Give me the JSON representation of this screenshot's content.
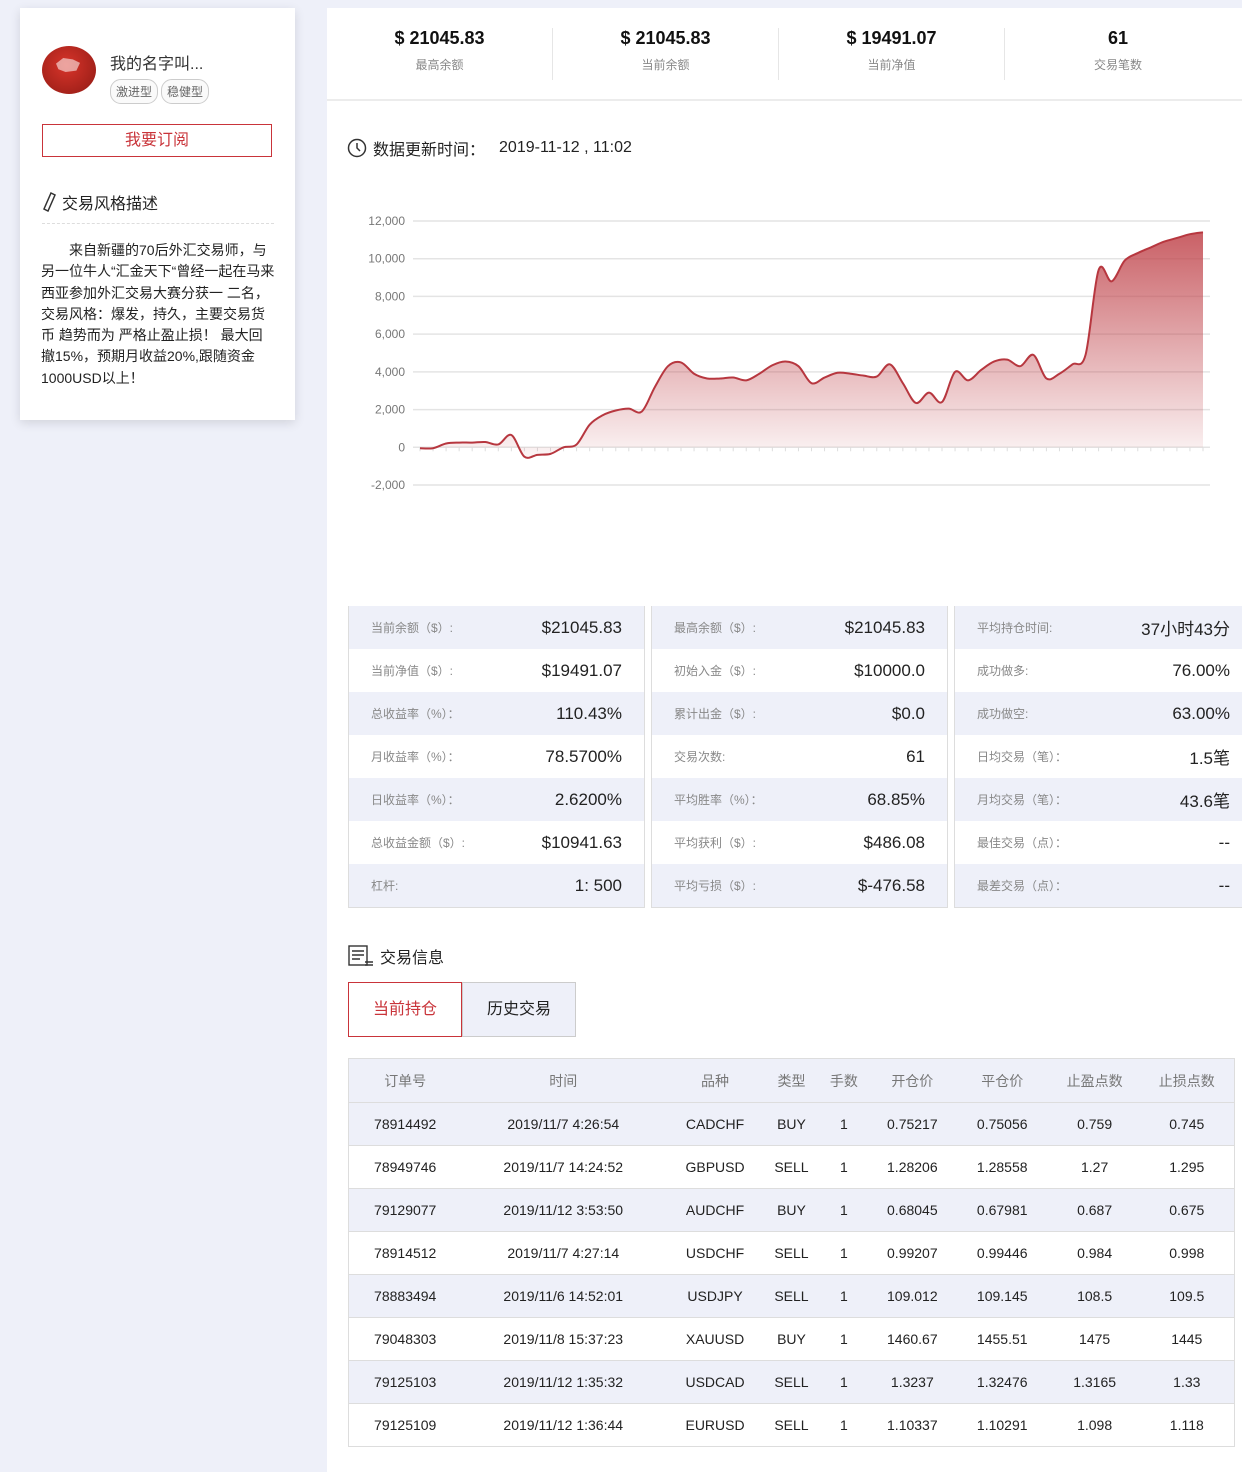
{
  "profile": {
    "name": "我的名字叫...",
    "tags": [
      "激进型",
      "稳健型"
    ],
    "subscribe": "我要订阅",
    "style_title": "交易风格描述",
    "description": "来自新疆的70后外汇交易师，与另一位牛人“汇金天下“曾经一起在马来西亚参加外汇交易大赛分获一 二名，交易风格：爆发，持久，主要交易货币 趋势而为  严格止盈止损！  最大回撤15%，预期月收益20%,跟随资金1000USD以上！"
  },
  "summary": [
    {
      "value": "$ 21045.83",
      "label": "最高余额"
    },
    {
      "value": "$ 21045.83",
      "label": "当前余额"
    },
    {
      "value": "$ 19491.07",
      "label": "当前净值"
    },
    {
      "value": "61",
      "label": "交易笔数"
    }
  ],
  "update": {
    "label": "数据更新时间：",
    "time": "2019-11-12 , 11:02"
  },
  "chart_data": {
    "type": "area",
    "title": "",
    "xlabel": "",
    "ylabel": "",
    "ylim": [
      -2000,
      12000
    ],
    "yticks": [
      "12,000",
      "10,000",
      "8,000",
      "6,000",
      "4,000",
      "2,000",
      "0",
      "-2,000"
    ],
    "grid": true,
    "color": "#c0444b",
    "values": [
      -50,
      -50,
      200,
      250,
      250,
      280,
      150,
      650,
      -500,
      -400,
      -350,
      0,
      150,
      1200,
      1700,
      1950,
      2050,
      1900,
      3200,
      4300,
      4500,
      3900,
      3650,
      3650,
      3700,
      3550,
      3900,
      4350,
      4550,
      4300,
      3400,
      3700,
      3950,
      3900,
      3800,
      3750,
      4400,
      3400,
      2350,
      2900,
      2400,
      4000,
      3550,
      4100,
      4550,
      4650,
      4300,
      4900,
      3650,
      3900,
      4400,
      4900,
      9400,
      8800,
      9900,
      10300,
      10600,
      10900,
      11100,
      11300,
      11400
    ]
  },
  "stats": [
    [
      [
        "当前余额（$）:",
        "$21045.83"
      ],
      [
        "当前净值（$）:",
        "$19491.07"
      ],
      [
        "总收益率（%）：",
        "110.43%"
      ],
      [
        "月收益率（%）：",
        "78.5700%"
      ],
      [
        "日收益率（%）：",
        "2.6200%"
      ],
      [
        "总收益金额（$）:",
        "$10941.63"
      ],
      [
        "杠杆:",
        "1:  500"
      ]
    ],
    [
      [
        "最高余额（$）:",
        "$21045.83"
      ],
      [
        "初始入金（$）:",
        "$10000.0"
      ],
      [
        "累计出金（$）:",
        "$0.0"
      ],
      [
        "交易次数:",
        "61"
      ],
      [
        "平均胜率（%）：",
        "68.85%"
      ],
      [
        "平均获利（$）:",
        "$486.08"
      ],
      [
        "平均亏损（$）:",
        "$-476.58"
      ]
    ],
    [
      [
        "平均持仓时间:",
        "37小时43分"
      ],
      [
        "成功做多:",
        "76.00%"
      ],
      [
        "成功做空:",
        "63.00%"
      ],
      [
        "日均交易（笔）：",
        "1.5笔"
      ],
      [
        "月均交易（笔）：",
        "43.6笔"
      ],
      [
        "最佳交易（点）：",
        "--"
      ],
      [
        "最差交易（点）：",
        "--"
      ]
    ]
  ],
  "trade": {
    "title": "交易信息",
    "tabs": [
      "当前持仓",
      "历史交易"
    ],
    "columns": [
      "订单号",
      "时间",
      "品种",
      "类型",
      "手数",
      "开仓价",
      "平仓价",
      "止盈点数",
      "止损点数"
    ],
    "rows": [
      [
        "78914492",
        "2019/11/7 4:26:54",
        "CADCHF",
        "BUY",
        "1",
        "0.75217",
        "0.75056",
        "0.759",
        "0.745"
      ],
      [
        "78949746",
        "2019/11/7 14:24:52",
        "GBPUSD",
        "SELL",
        "1",
        "1.28206",
        "1.28558",
        "1.27",
        "1.295"
      ],
      [
        "79129077",
        "2019/11/12 3:53:50",
        "AUDCHF",
        "BUY",
        "1",
        "0.68045",
        "0.67981",
        "0.687",
        "0.675"
      ],
      [
        "78914512",
        "2019/11/7 4:27:14",
        "USDCHF",
        "SELL",
        "1",
        "0.99207",
        "0.99446",
        "0.984",
        "0.998"
      ],
      [
        "78883494",
        "2019/11/6 14:52:01",
        "USDJPY",
        "SELL",
        "1",
        "109.012",
        "109.145",
        "108.5",
        "109.5"
      ],
      [
        "79048303",
        "2019/11/8 15:37:23",
        "XAUUSD",
        "BUY",
        "1",
        "1460.67",
        "1455.51",
        "1475",
        "1445"
      ],
      [
        "79125103",
        "2019/11/12 1:35:32",
        "USDCAD",
        "SELL",
        "1",
        "1.3237",
        "1.32476",
        "1.3165",
        "1.33"
      ],
      [
        "79125109",
        "2019/11/12 1:36:44",
        "EURUSD",
        "SELL",
        "1",
        "1.10337",
        "1.10291",
        "1.098",
        "1.118"
      ]
    ]
  }
}
